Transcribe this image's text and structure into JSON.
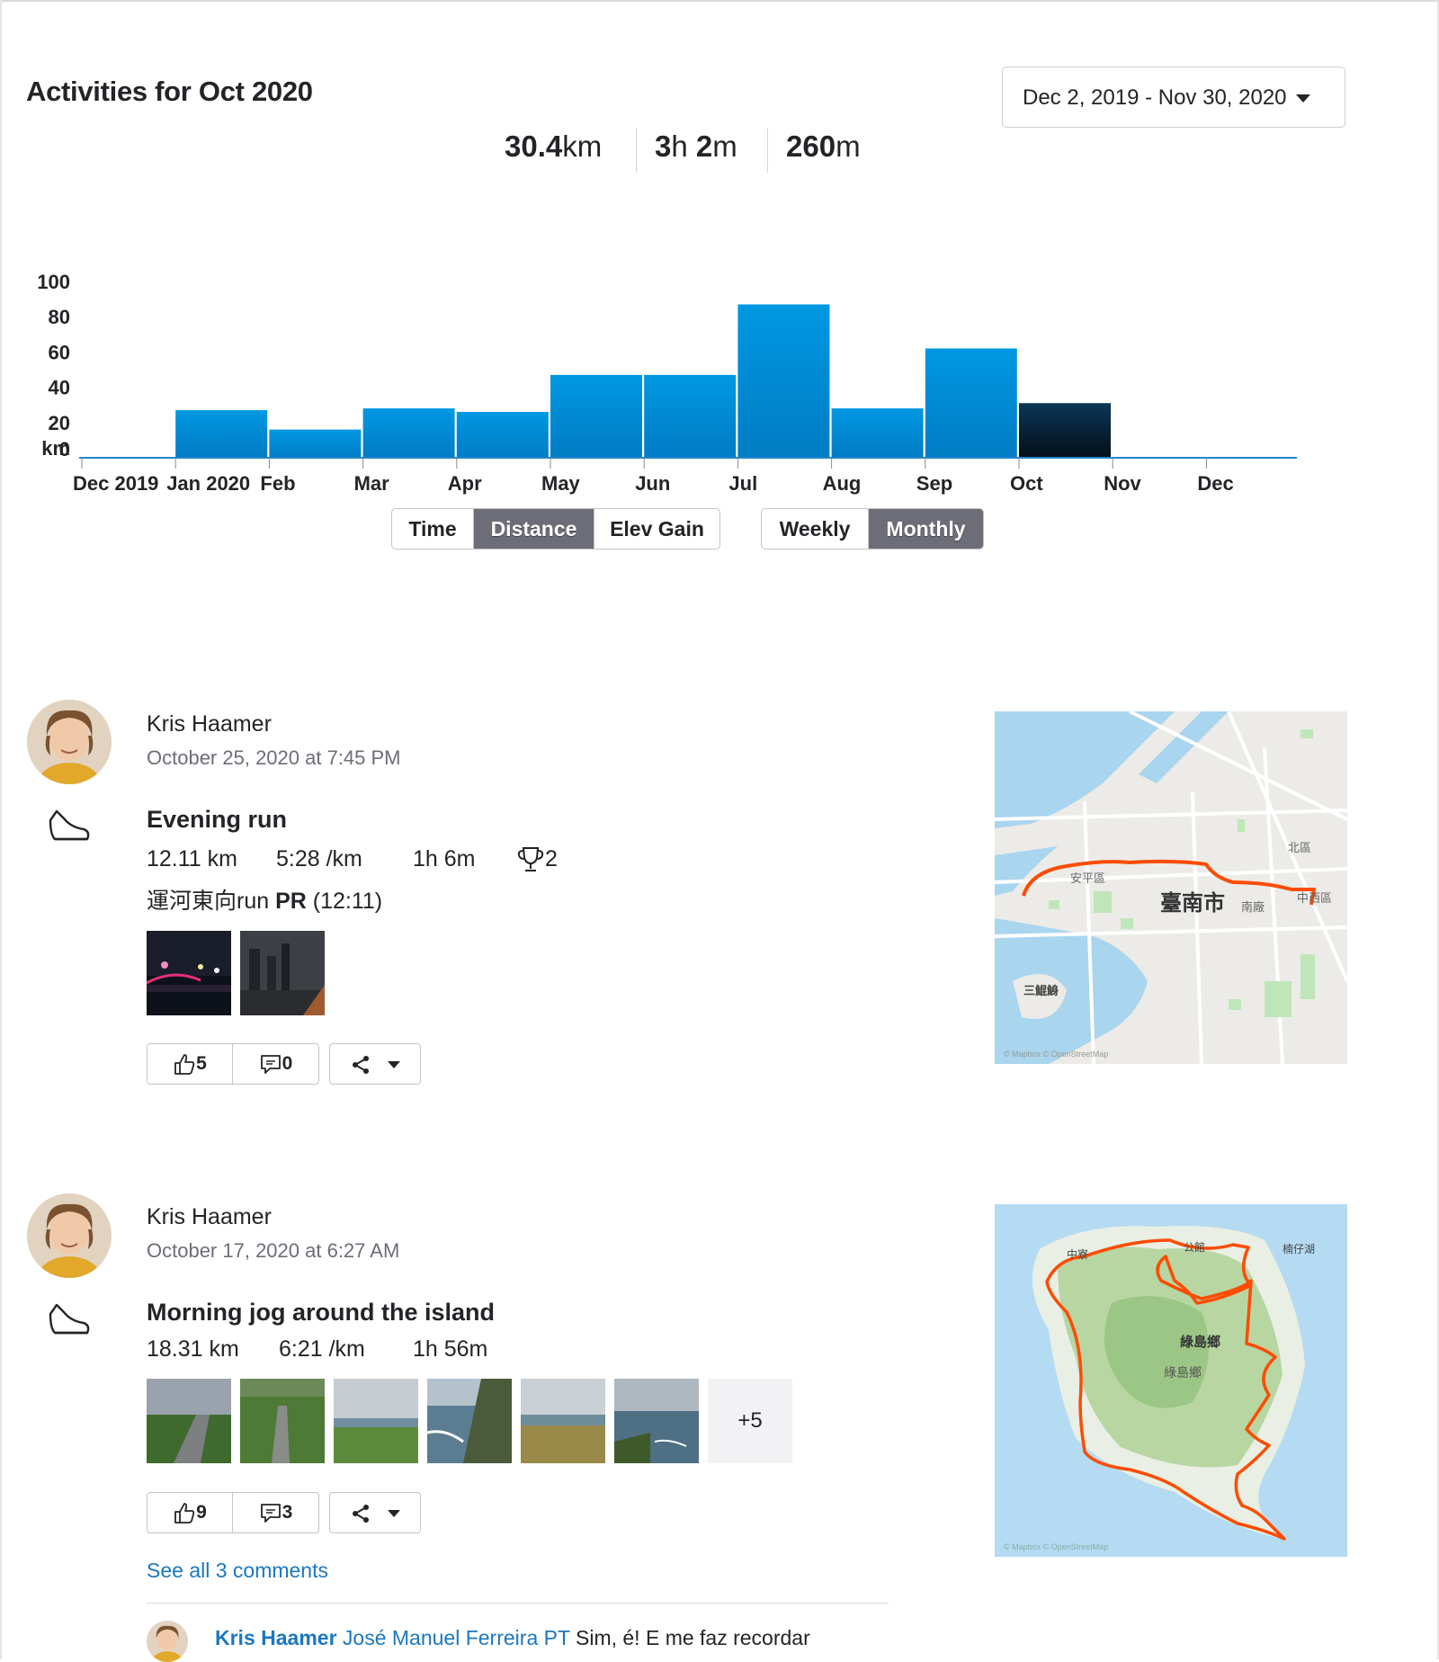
{
  "header": {
    "title": "Activities for Oct 2020",
    "date_range": "Dec 2, 2019 - Nov 30, 2020"
  },
  "totals": {
    "distance_value": "30.4",
    "distance_unit": "km",
    "time_h": "3",
    "time_h_unit": "h ",
    "time_m": "2",
    "time_m_unit": "m",
    "elev_value": "260",
    "elev_unit": "m"
  },
  "chart_data": {
    "type": "bar",
    "categories": [
      "Dec 2019",
      "Jan 2020",
      "Feb",
      "Mar",
      "Apr",
      "May",
      "Jun",
      "Jul",
      "Aug",
      "Sep",
      "Oct",
      "Nov",
      "Dec"
    ],
    "values": [
      0,
      27,
      16,
      28,
      26,
      47,
      47,
      87,
      28,
      62,
      31,
      0,
      0
    ],
    "selected_category": "Oct",
    "ylabel": "km",
    "yticks": [
      0,
      20,
      40,
      60,
      80,
      100
    ],
    "ylim": [
      0,
      100
    ],
    "bar_color": "#0095e0",
    "selected_color": "#0a2238"
  },
  "metric_toggle": {
    "options": [
      "Time",
      "Distance",
      "Elev Gain"
    ],
    "selected": "Distance"
  },
  "period_toggle": {
    "options": [
      "Weekly",
      "Monthly"
    ],
    "selected": "Monthly"
  },
  "activities": [
    {
      "athlete": "Kris Haamer",
      "date": "October 25, 2020 at 7:45 PM",
      "title": "Evening run",
      "distance": "12.11 km",
      "pace": "5:28 /km",
      "time": "1h 6m",
      "achievements": "2",
      "segment_name": "運河東向run",
      "segment_pr_label": "PR",
      "segment_pr_time": "(12:11)",
      "kudos": "5",
      "comments": "0",
      "map_labels": [
        "安平區",
        "北區",
        "臺南市",
        "南廠",
        "中西區",
        "三鯤鯓"
      ],
      "map_attribution": "© Mapbox © OpenStreetMap"
    },
    {
      "athlete": "Kris Haamer",
      "date": "October 17, 2020 at 6:27 AM",
      "title": "Morning jog around the island",
      "distance": "18.31 km",
      "pace": "6:21 /km",
      "time": "1h 56m",
      "more_photos": "+5",
      "kudos": "9",
      "comments": "3",
      "see_all_comments": "See all 3 comments",
      "map_labels": [
        "中寮",
        "公館",
        "楠仔湖",
        "綠島鄉",
        "綠島鄉"
      ],
      "map_attribution": "© Mapbox © OpenStreetMap",
      "comment": {
        "author": "Kris Haamer",
        "mention": "José Manuel Ferreira PT",
        "text": " Sim, é! E me faz recordar"
      }
    }
  ],
  "colors": {
    "accent_blue": "#1b77bf",
    "route_orange": "#fc4c02",
    "selected_toggle": "#6d6d78"
  }
}
